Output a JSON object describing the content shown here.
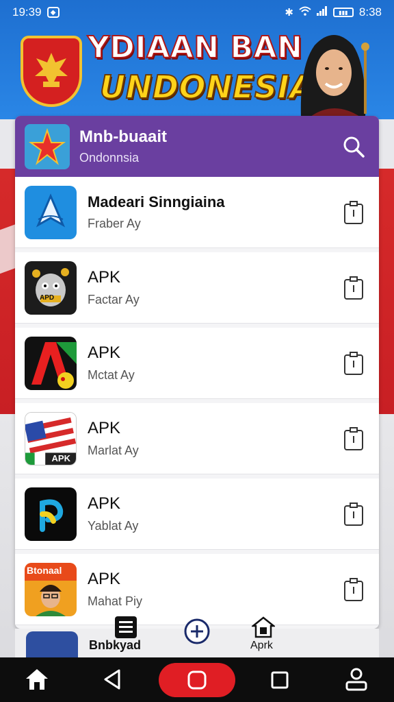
{
  "status_bar": {
    "time_left": "19:39",
    "time_right": "8:38",
    "icons": [
      "notification-icon",
      "bluetooth-icon",
      "wifi-icon",
      "signal-icon",
      "battery-icon"
    ]
  },
  "banner": {
    "title_line1": "YDIAAN BAN",
    "title_line2": "UNDONESIA"
  },
  "header": {
    "title": "Mnb-buaait",
    "subtitle": "Ondonnsia"
  },
  "apps": [
    {
      "title": "Madeari Sinngiaina",
      "subtitle": "Fraber Ay",
      "icon": "paper-plane-icon"
    },
    {
      "title": "APK",
      "subtitle": "Factar Ay",
      "icon": "robot-mascot-icon"
    },
    {
      "title": "APK",
      "subtitle": "Mctat Ay",
      "icon": "letter-a-icon"
    },
    {
      "title": "APK",
      "subtitle": "Marlat Ay",
      "icon": "flag-apk-icon"
    },
    {
      "title": "APK",
      "subtitle": "Yablat Ay",
      "icon": "p-logo-icon"
    },
    {
      "title": "APK",
      "subtitle": "Mahat Piy",
      "icon": "portrait-app-icon"
    }
  ],
  "app_icon_labels": {
    "robot": "APD",
    "flag": "APK",
    "portrait": "Btonaal"
  },
  "bottom_tabs": {
    "tab1_label": "Bnbkyad",
    "tab3_label": "Aprk"
  },
  "colors": {
    "header": "#6a3fa0",
    "banner_blue": "#1e6fd0",
    "flag_red": "#c81f24",
    "nav_pill": "#e01e24"
  }
}
